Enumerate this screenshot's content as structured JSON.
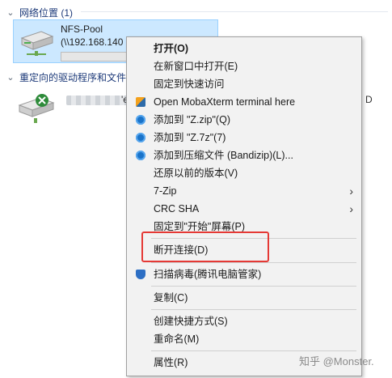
{
  "explorer": {
    "network_group": {
      "title": "网络位置 (1)"
    },
    "nfs_tile": {
      "name": "NFS-Pool",
      "path": "(\\\\192.168.140",
      "progress": 0.0
    },
    "redirected_group": {
      "title": "重定向的驱动程序和文件"
    },
    "blurred_item": {
      "tail": "'e",
      "right_fragment": "D"
    }
  },
  "context_menu": {
    "items": [
      {
        "id": "open",
        "label": "打开(O)",
        "bold": true
      },
      {
        "id": "open-new-window",
        "label": "在新窗口中打开(E)"
      },
      {
        "id": "pin-quick-access",
        "label": "固定到快速访问"
      },
      {
        "id": "mobaxterm",
        "label": "Open MobaXterm terminal here",
        "icon": "mobaxterm-icon"
      },
      {
        "id": "add-zip",
        "label": "添加到 \"Z.zip\"(Q)",
        "icon": "bandizip-icon"
      },
      {
        "id": "add-7z",
        "label": "添加到 \"Z.7z\"(7)",
        "icon": "bandizip-icon"
      },
      {
        "id": "add-archive",
        "label": "添加到压缩文件 (Bandizip)(L)...",
        "icon": "bandizip-icon"
      },
      {
        "id": "restore-previous",
        "label": "还原以前的版本(V)"
      },
      {
        "id": "7zip",
        "label": "7-Zip",
        "submenu": true
      },
      {
        "id": "crc-sha",
        "label": "CRC SHA",
        "submenu": true
      },
      {
        "id": "pin-start",
        "label": "固定到\"开始\"屏幕(P)"
      },
      {
        "id": "disconnect",
        "label": "断开连接(D)"
      },
      {
        "id": "scan-virus",
        "label": "扫描病毒(腾讯电脑管家)",
        "icon": "shield-icon"
      },
      {
        "id": "copy",
        "label": "复制(C)"
      },
      {
        "id": "create-shortcut",
        "label": "创建快捷方式(S)"
      },
      {
        "id": "rename",
        "label": "重命名(M)"
      },
      {
        "id": "properties",
        "label": "属性(R)"
      }
    ]
  },
  "watermark": {
    "text": "知乎 @Monster."
  },
  "colors": {
    "menu_bg": "#f2f2f2",
    "selected_tile": "#cce8ff",
    "highlight_box": "#e53935"
  }
}
